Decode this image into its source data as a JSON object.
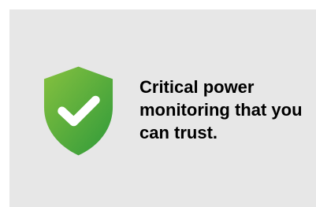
{
  "hero": {
    "icon": "shield-check-icon",
    "headline": "Critical power monitoring that you can trust.",
    "colors": {
      "background": "#e7e7e7",
      "shield_gradient_start": "#86c13f",
      "shield_gradient_end": "#2f9a3a",
      "check": "#ffffff",
      "text": "#000000"
    }
  }
}
